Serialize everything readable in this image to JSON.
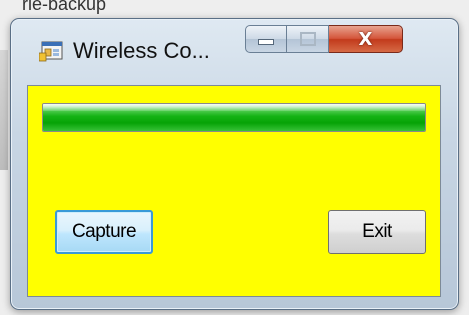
{
  "background": {
    "partial_text": "rle-backup"
  },
  "window": {
    "title": "Wireless Co...",
    "icon": "application-window-icon",
    "controls": {
      "minimize": "minimize-icon",
      "maximize": "maximize-icon",
      "close_label": "X"
    }
  },
  "client": {
    "background_color": "#ffff00",
    "progress": {
      "value_percent": 100,
      "color": "#10b010"
    },
    "buttons": {
      "capture_label": "Capture",
      "exit_label": "Exit"
    }
  }
}
